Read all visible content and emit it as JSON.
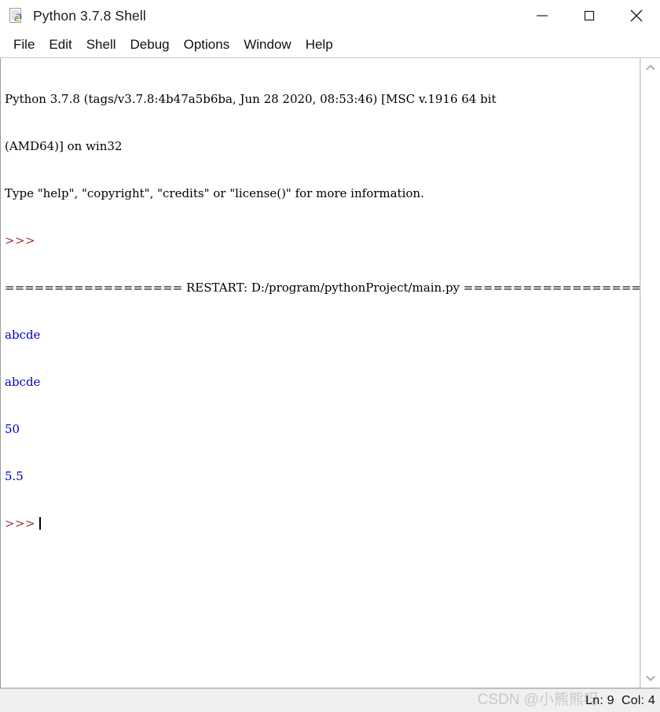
{
  "window": {
    "title": "Python 3.7.8 Shell",
    "icon": "python-shell-icon",
    "controls": [
      {
        "name": "minimize-button",
        "glyph": "minimize"
      },
      {
        "name": "maximize-button",
        "glyph": "maximize"
      },
      {
        "name": "close-button",
        "glyph": "close"
      }
    ]
  },
  "menubar": {
    "items": [
      {
        "label": "File"
      },
      {
        "label": "Edit"
      },
      {
        "label": "Shell"
      },
      {
        "label": "Debug"
      },
      {
        "label": "Options"
      },
      {
        "label": "Window"
      },
      {
        "label": "Help"
      }
    ]
  },
  "console": {
    "lines": [
      {
        "type": "stdout-banner",
        "text": "Python 3.7.8 (tags/v3.7.8:4b47a5b6ba, Jun 28 2020, 08:53:46) [MSC v.1916 64 bit"
      },
      {
        "type": "stdout-banner",
        "text": "(AMD64)] on win32"
      },
      {
        "type": "stdout-banner",
        "text": "Type \"help\", \"copyright\", \"credits\" or \"license()\" for more information."
      },
      {
        "type": "prompt",
        "text": ">>>"
      },
      {
        "type": "restart",
        "text": "================== RESTART: D:/program/pythonProject/main.py =================="
      },
      {
        "type": "stdout",
        "text": "abcde"
      },
      {
        "type": "stdout",
        "text": "abcde"
      },
      {
        "type": "stdout",
        "text": "50"
      },
      {
        "type": "stdout",
        "text": "5.5"
      },
      {
        "type": "prompt-cursor",
        "text": ">>>"
      }
    ]
  },
  "scrollbar": {
    "up_arrow": "chevron-up-icon",
    "down_arrow": "chevron-down-icon"
  },
  "statusbar": {
    "position": "Ln: 9  Col: 4",
    "watermark": "CSDN @小熊熊呀"
  },
  "colors": {
    "stdout_blue": "#0000cc",
    "prompt_maroon": "#a03030",
    "window_bg": "#ffffff",
    "statusbar_bg": "#f0f0f0"
  }
}
